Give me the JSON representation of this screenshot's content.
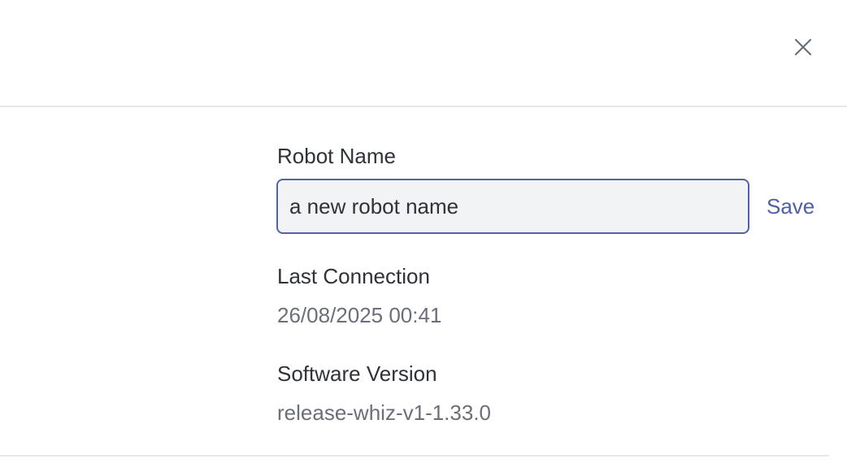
{
  "dialog": {
    "close_icon": "close-icon"
  },
  "robot_name": {
    "label": "Robot Name",
    "value": "a new robot name",
    "save_label": "Save"
  },
  "last_connection": {
    "label": "Last Connection",
    "value": "26/08/2025 00:41"
  },
  "software_version": {
    "label": "Software Version",
    "value": "release-whiz-v1-1.33.0"
  },
  "colors": {
    "accent": "#4f5ea6",
    "input_border": "#5463a6",
    "input_background": "#f2f3f5",
    "label_text": "#2f3238",
    "value_text": "#6b6f78",
    "divider": "#e6e7ea"
  }
}
